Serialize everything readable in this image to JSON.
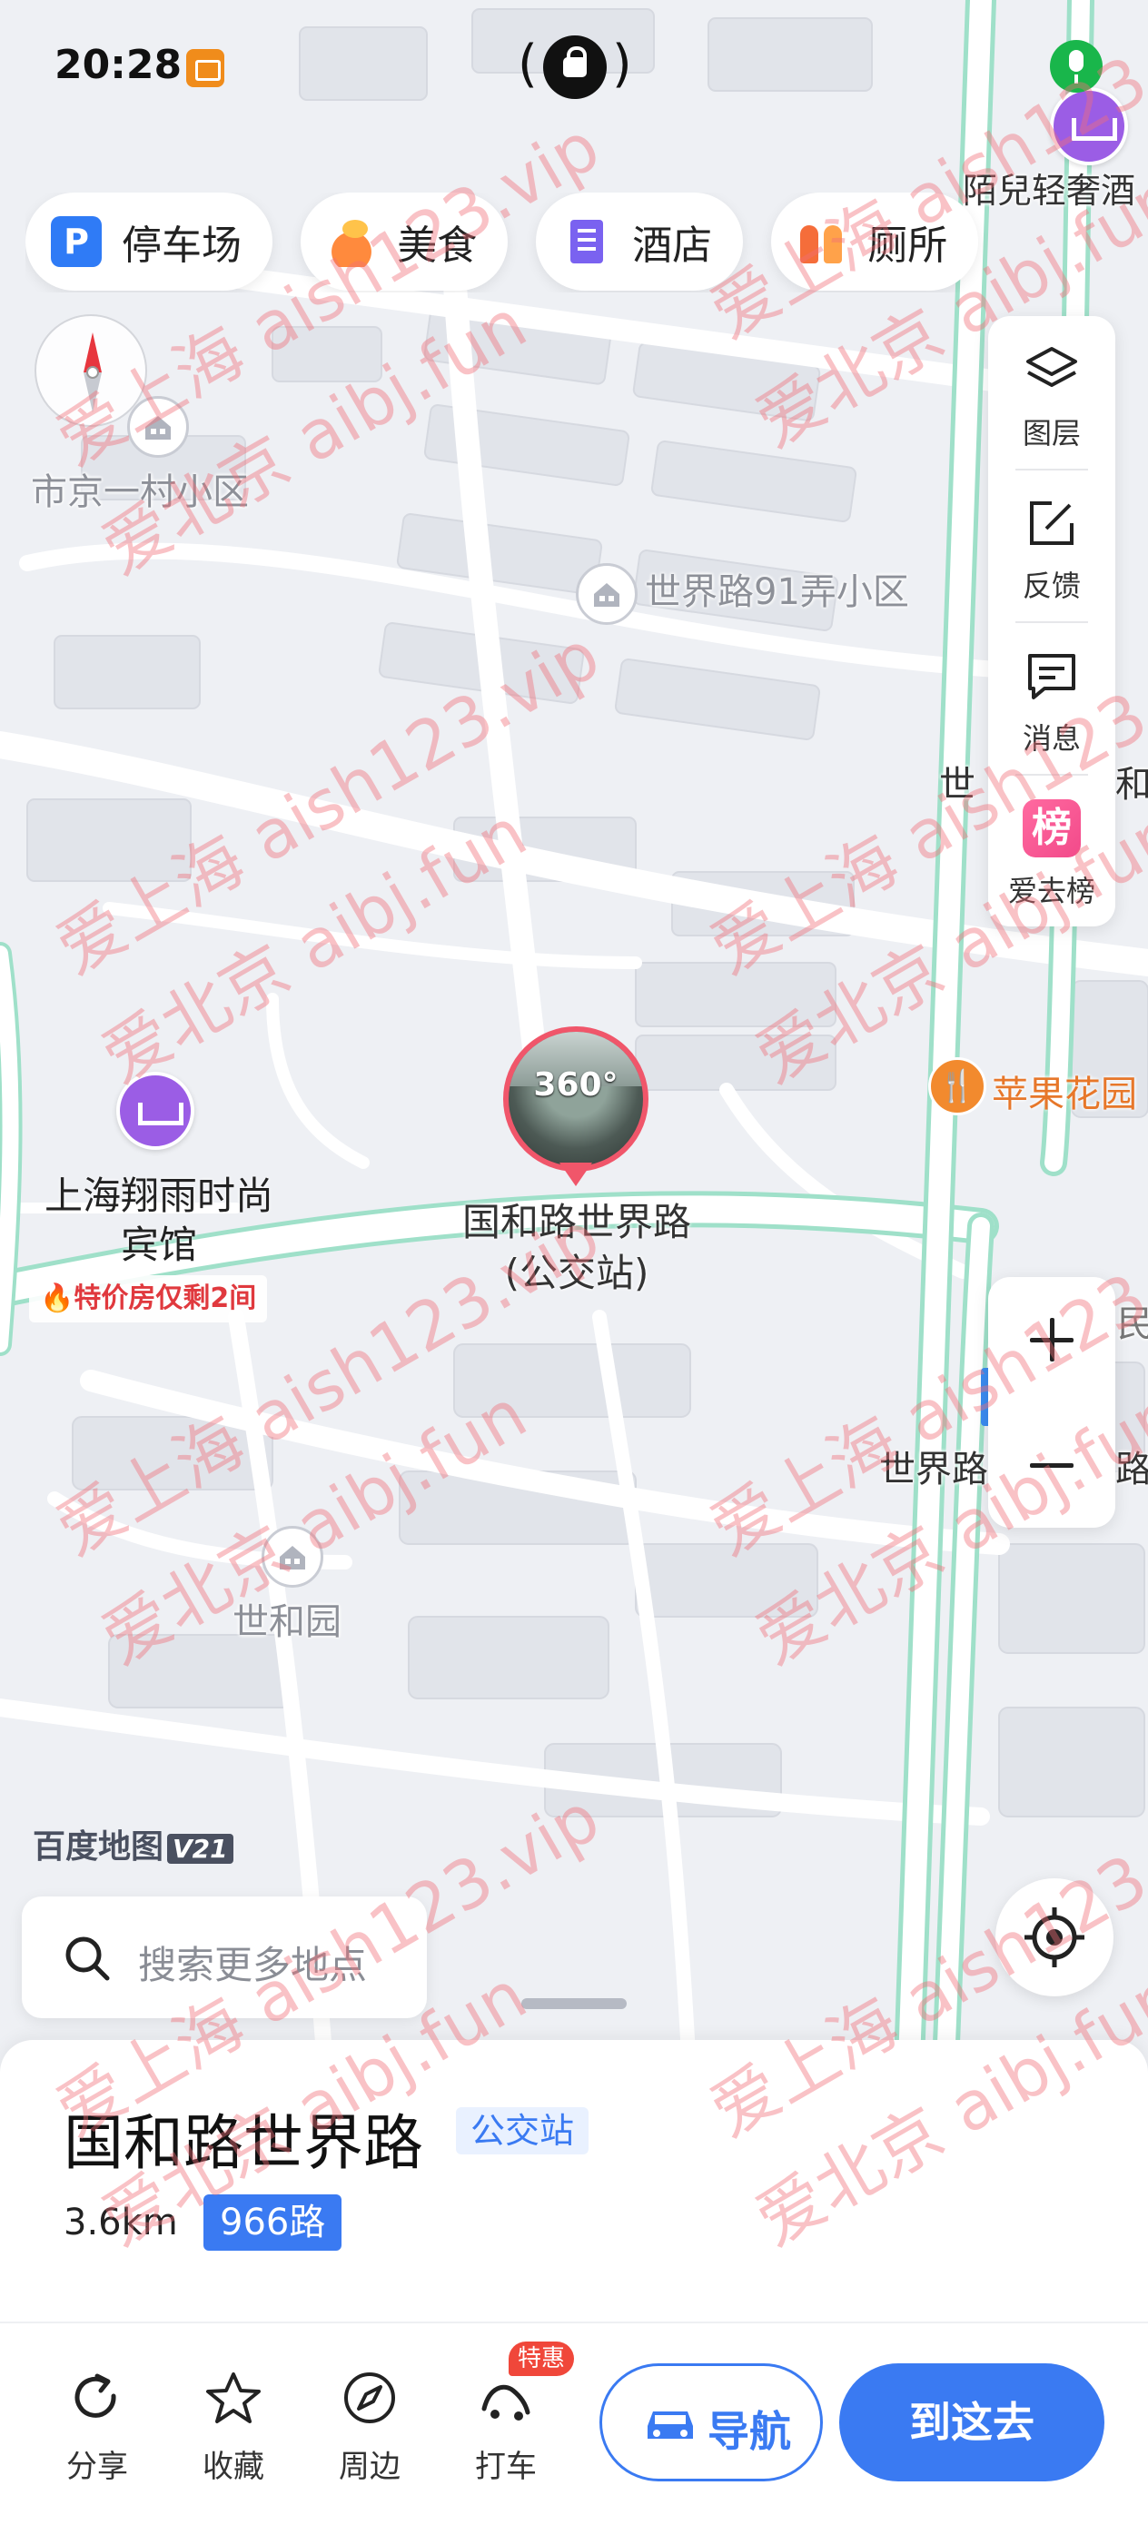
{
  "status_bar": {
    "time": "20:28",
    "center_left": "(",
    "center_right": ")"
  },
  "categories": [
    {
      "label": "停车场",
      "icon": "parking-icon"
    },
    {
      "label": "美食",
      "icon": "food-icon"
    },
    {
      "label": "酒店",
      "icon": "hotel-icon"
    },
    {
      "label": "厕所",
      "icon": "toilet-icon"
    }
  ],
  "tools": [
    {
      "label": "图层",
      "icon": "layers-icon"
    },
    {
      "label": "反馈",
      "icon": "feedback-icon"
    },
    {
      "label": "消息",
      "icon": "message-icon"
    },
    {
      "label": "爱去榜",
      "icon": "ranking-icon",
      "glyph": "榜"
    }
  ],
  "map": {
    "poi_labels": {
      "shijingyicun": "市京一村小区",
      "shijielu91": "世界路91弄小区",
      "shiheyuan": "世和园",
      "shijie_partial": "世",
      "he_partial": "和",
      "shijielu_partial": "世界路",
      "lu_partial": "路",
      "min_partial": "民",
      "top_right_partial": "陌兒轻奢酒"
    },
    "hotel": {
      "name": "上海翔雨时尚宾馆",
      "promo": "特价房仅剩2间"
    },
    "food": {
      "name": "苹果花园"
    },
    "stop_marker": {
      "badge": "360°",
      "label_line1": "国和路世界路",
      "label_line2": "(公交站)"
    },
    "logo": "百度地图",
    "logo_version": "V21"
  },
  "search": {
    "placeholder": "搜索更多地点"
  },
  "sheet": {
    "title": "国和路世界路",
    "type": "公交站",
    "distance": "3.6km",
    "route": "966路"
  },
  "actions": {
    "share": "分享",
    "favorite": "收藏",
    "nearby": "周边",
    "taxi": "打车",
    "taxi_badge": "特惠",
    "navigate": "导航",
    "go_here": "到这去"
  },
  "watermark": {
    "line1": "爱上海 aish123.vip",
    "line2": "爱北京 aibj.fun"
  },
  "colors": {
    "accent": "#3a7af2",
    "marker": "#f0566a",
    "hotel": "#9b5de5",
    "food": "#f28a2e",
    "promo": "#e0393e"
  }
}
